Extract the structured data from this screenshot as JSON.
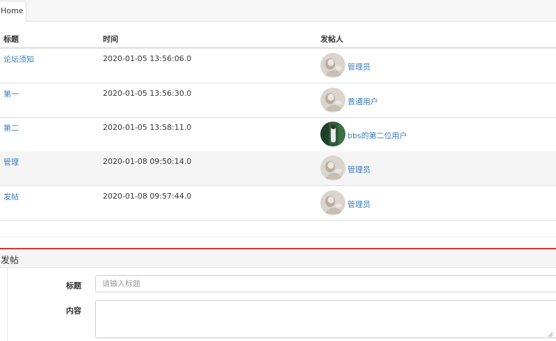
{
  "tabs": [
    {
      "label": "Home",
      "active": true
    }
  ],
  "table": {
    "headers": {
      "title": "标题",
      "time": "时间",
      "author": "发帖人"
    },
    "rows": [
      {
        "title": "论坛须知",
        "time": "2020-01-05 13:56:06.0",
        "author": "管理员",
        "avatar": "admin-avatar"
      },
      {
        "title": "第一",
        "time": "2020-01-05 13:56:30.0",
        "author": "普通用户",
        "avatar": "user-avatar"
      },
      {
        "title": "第二",
        "time": "2020-01-05 13:58:11.0",
        "author": "bbs的第二位用户",
        "avatar": "green-photo-avatar"
      },
      {
        "title": "管理",
        "time": "2020-01-08 09:50:14.0",
        "author": "管理员",
        "avatar": "admin-avatar"
      },
      {
        "title": "发帖",
        "time": "2020-01-08 09:57:44.0",
        "author": "管理员",
        "avatar": "admin-avatar"
      }
    ]
  },
  "post_form": {
    "heading": "发帖",
    "title_label": "标题",
    "title_placeholder": "请输入标题",
    "title_value": "",
    "content_label": "内容",
    "content_value": ""
  },
  "colors": {
    "link": "#3a7bbf",
    "accent_line": "#d9302c",
    "row_alt": "#f5f5f5",
    "border": "#dddddd"
  }
}
